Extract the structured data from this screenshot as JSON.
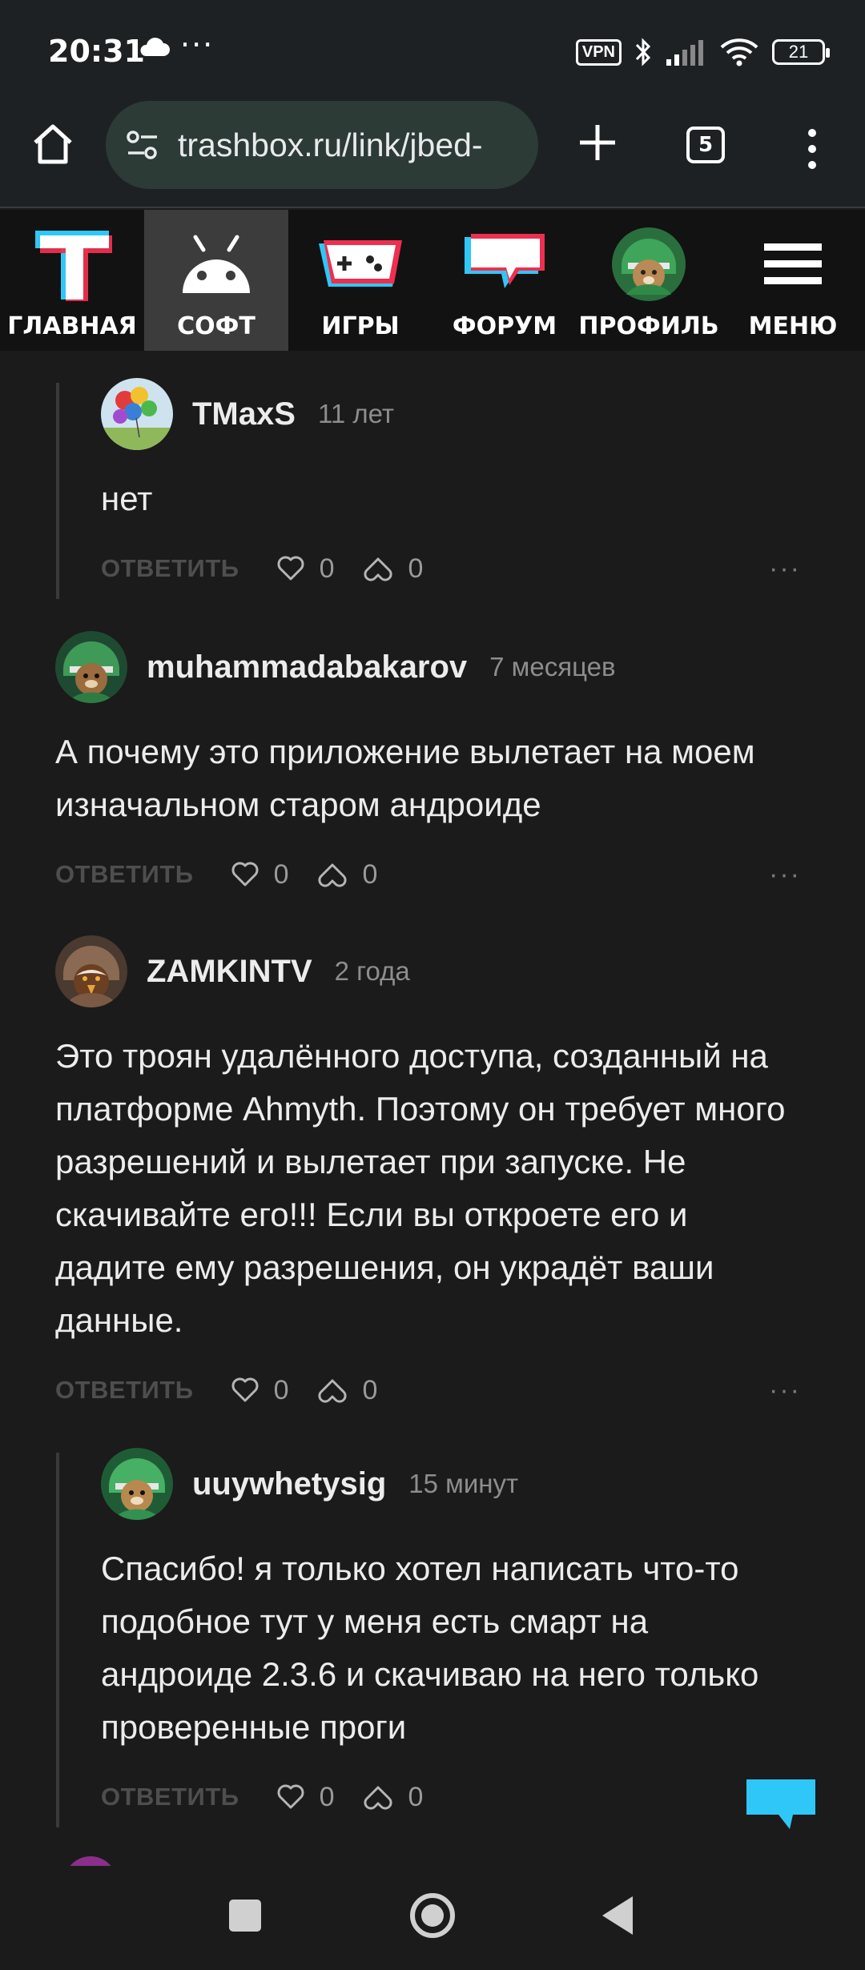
{
  "status_bar": {
    "time": "20:31",
    "dots": "···",
    "vpn": "VPN",
    "battery": "21"
  },
  "browser": {
    "url": "trashbox.ru/link/jbed-",
    "tab_count": "5"
  },
  "site_nav": [
    {
      "label": "ГЛАВНАЯ",
      "icon": "trashbox-t-logo-icon"
    },
    {
      "label": "СОФТ",
      "icon": "android-icon"
    },
    {
      "label": "ИГРЫ",
      "icon": "gamepad-icon"
    },
    {
      "label": "ФОРУМ",
      "icon": "forum-bubble-icon"
    },
    {
      "label": "ПРОФИЛЬ",
      "icon": "profile-avatar-icon"
    },
    {
      "label": "МЕНЮ",
      "icon": "hamburger-menu-icon"
    }
  ],
  "comments": [
    {
      "author": "TMaxS",
      "time": "11 лет",
      "text": "нет",
      "reply": "ОТВЕТИТЬ",
      "likes": "0",
      "dislikes": "0",
      "nested": true
    },
    {
      "author": "muhammadabakarov",
      "time": "7 месяцев",
      "text": "А почему это приложение вылетает на моем изначальном старом андроиде",
      "reply": "ОТВЕТИТЬ",
      "likes": "0",
      "dislikes": "0",
      "nested": false
    },
    {
      "author": "ZAMKINTV",
      "time": "2 года",
      "text": "Это троян удалённого доступа, созданный на платформе Ahmyth. Поэтому он требует много разрешений и вылетает при запуске. Не скачивайте его!!! Если вы откроете его и дадите ему разрешения, он украдёт ваши данные.",
      "reply": "ОТВЕТИТЬ",
      "likes": "0",
      "dislikes": "0",
      "nested": false
    },
    {
      "author": "uuywhetysig",
      "time": "15 минут",
      "text": "Спасибо! я только хотел написать что-то подобное тут у меня есть смарт на андроиде 2.3.6 и скачиваю на него только проверенные проги",
      "reply": "ОТВЕТИТЬ",
      "likes": "0",
      "dislikes": "0",
      "nested": true
    }
  ],
  "colors": {
    "accent_cyan": "#2fc7f7",
    "accent_red": "#ee2f4f",
    "background": "#1b1b1b"
  }
}
